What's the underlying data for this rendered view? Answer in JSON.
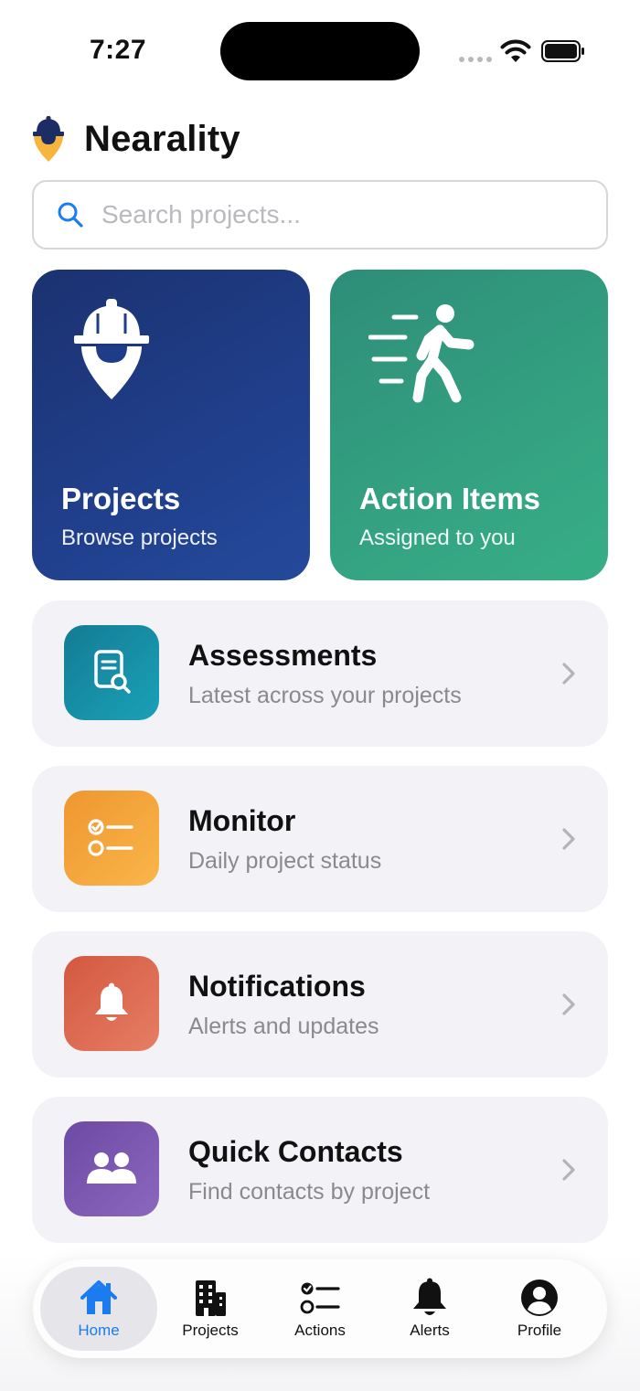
{
  "status_bar": {
    "time": "7:27"
  },
  "app": {
    "name": "Nearality"
  },
  "search": {
    "placeholder": "Search projects..."
  },
  "tiles": [
    {
      "title": "Projects",
      "subtitle": "Browse projects",
      "icon": "hardhat-pin-icon"
    },
    {
      "title": "Action Items",
      "subtitle": "Assigned to you",
      "icon": "walking-person-icon"
    }
  ],
  "cards": [
    {
      "title": "Assessments",
      "subtitle": "Latest across your projects",
      "icon": "document-search-icon",
      "color": "#178a9e"
    },
    {
      "title": "Monitor",
      "subtitle": "Daily project status",
      "icon": "checklist-icon",
      "color": "#f3a43a"
    },
    {
      "title": "Notifications",
      "subtitle": "Alerts and updates",
      "icon": "bell-icon",
      "color": "#dd6a52"
    },
    {
      "title": "Quick Contacts",
      "subtitle": "Find contacts by project",
      "icon": "people-icon",
      "color": "#7b55ae"
    }
  ],
  "tabbar": {
    "active": "Home",
    "items": [
      {
        "label": "Home",
        "icon": "home-icon"
      },
      {
        "label": "Projects",
        "icon": "building-icon"
      },
      {
        "label": "Actions",
        "icon": "checklist-icon"
      },
      {
        "label": "Alerts",
        "icon": "bell-icon"
      },
      {
        "label": "Profile",
        "icon": "person-circle-icon"
      }
    ]
  },
  "colors": {
    "accent": "#1a7cf0",
    "projects_tile": "#1f3c88",
    "actions_tile": "#33a080",
    "card_bg": "#f2f2f7"
  }
}
